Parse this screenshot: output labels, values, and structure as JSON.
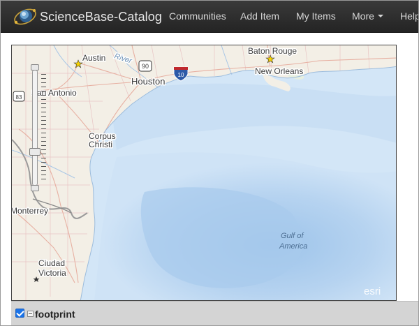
{
  "navbar": {
    "brand": "ScienceBase-Catalog",
    "items": [
      {
        "label": "Communities"
      },
      {
        "label": "Add Item"
      },
      {
        "label": "My Items"
      },
      {
        "label": "More"
      },
      {
        "label": "Help"
      }
    ]
  },
  "map": {
    "places": {
      "austin": "Austin",
      "baton_rouge": "Baton Rouge",
      "new_orleans": "New Orleans",
      "houston": "Houston",
      "san_antonio": "San Antonio",
      "corpus": "Corpus",
      "christi": "Christi",
      "monterrey": "Monterrey",
      "ciudad": "Ciudad",
      "victoria": "Victoria",
      "river": "River",
      "gulf_line1": "Gulf of",
      "gulf_line2": "America"
    },
    "shields": {
      "i10": "10",
      "us90": "90",
      "us83": "83"
    },
    "attribution": "esri"
  },
  "legend": {
    "layer_name": "footprint",
    "checked": true
  }
}
